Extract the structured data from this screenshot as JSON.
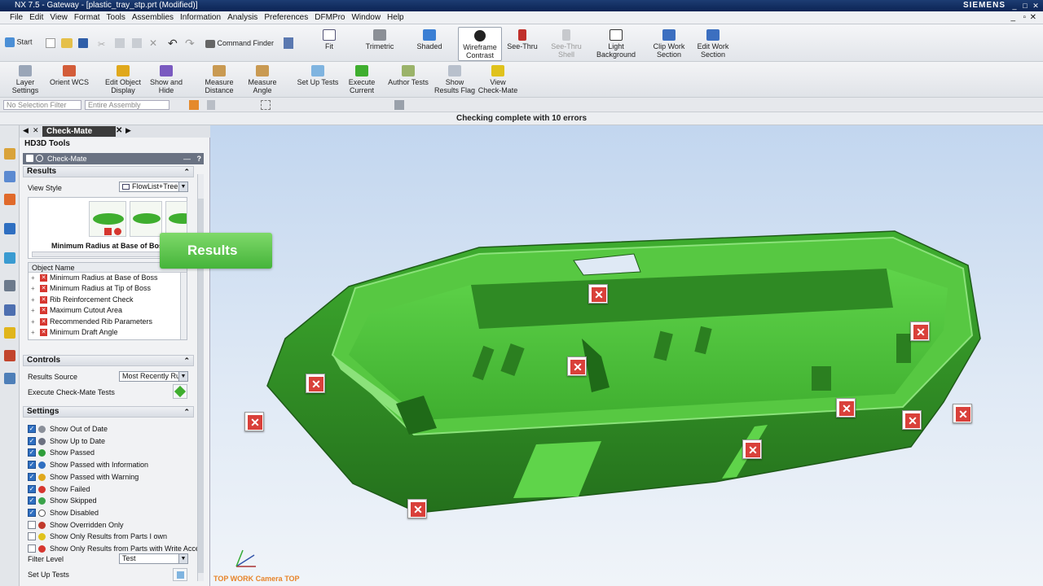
{
  "window": {
    "title": "NX 7.5 - Gateway - [plastic_tray_stp.prt (Modified)]",
    "brand": "SIEMENS"
  },
  "menu": [
    "File",
    "Edit",
    "View",
    "Format",
    "Tools",
    "Assemblies",
    "Information",
    "Analysis",
    "Preferences",
    "DFMPro",
    "Window",
    "Help"
  ],
  "toolbar1": {
    "start": "Start",
    "command_finder": "Command Finder",
    "fit": "Fit",
    "trimetric": "Trimetric",
    "shaded": "Shaded",
    "wireframe_1": "Wireframe",
    "wireframe_2": "Contrast",
    "see_thru": "See-Thru",
    "see_thru_shell_1": "See-Thru",
    "see_thru_shell_2": "Shell",
    "light_bg_1": "Light",
    "light_bg_2": "Background",
    "clip_work_1": "Clip Work",
    "clip_work_2": "Section",
    "edit_work_1": "Edit Work",
    "edit_work_2": "Section"
  },
  "toolbar2": {
    "layer_1": "Layer",
    "layer_2": "Settings",
    "orient": "Orient WCS",
    "edit_obj_1": "Edit Object",
    "edit_obj_2": "Display",
    "show_hide_1": "Show and",
    "show_hide_2": "Hide",
    "measure_dist_1": "Measure",
    "measure_dist_2": "Distance",
    "measure_angle_1": "Measure",
    "measure_angle_2": "Angle",
    "setup_tests": "Set Up Tests",
    "execute_1": "Execute",
    "execute_2": "Current",
    "author_tests": "Author Tests",
    "show_flag_1": "Show",
    "show_flag_2": "Results Flag",
    "view_cm_1": "View",
    "view_cm_2": "Check-Mate"
  },
  "filter": {
    "selection": "No Selection Filter",
    "scope": "Entire Assembly"
  },
  "status": "Checking complete with 10 errors",
  "panel": {
    "tab": "Check-Mate",
    "hd3d": "HD3D Tools",
    "checkmate_header": "Check-Mate",
    "results_section": "Results",
    "view_style_label": "View Style",
    "view_style_value": "FlowList+Tree",
    "thumb_caption": "Minimum Radius at Base of Boss",
    "object_name_header": "Object Name",
    "results": [
      "Minimum Radius at Base of Boss",
      "Minimum Radius at Tip of Boss",
      "Rib Reinforcement Check",
      "Maximum Cutout Area",
      "Recommended Rib Parameters",
      "Minimum Draft Angle"
    ],
    "controls_section": "Controls",
    "results_source_label": "Results Source",
    "results_source_value": "Most Recently Run",
    "execute_label": "Execute Check-Mate Tests",
    "settings_section": "Settings",
    "settings": [
      {
        "label": "Show Out of Date",
        "checked": true,
        "icon_color": "#8a8f99"
      },
      {
        "label": "Show Up to Date",
        "checked": true,
        "icon_color": "#6b7080"
      },
      {
        "label": "Show Passed",
        "checked": true,
        "icon_color": "#2e9e3a"
      },
      {
        "label": "Show Passed with Information",
        "checked": true,
        "icon_color": "#2f6fc1"
      },
      {
        "label": "Show Passed with Warning",
        "checked": true,
        "icon_color": "#e0a81c"
      },
      {
        "label": "Show Failed",
        "checked": true,
        "icon_color": "#d6362f"
      },
      {
        "label": "Show Skipped",
        "checked": true,
        "icon_color": "#3aa34a"
      },
      {
        "label": "Show Disabled",
        "checked": true,
        "icon_color": "#ffffff"
      },
      {
        "label": "Show Overridden Only",
        "checked": false,
        "icon_color": "#c0392b"
      },
      {
        "label": "Show Only Results from Parts I own",
        "checked": false,
        "icon_color": "#e0c21c"
      },
      {
        "label": "Show Only Results from Parts with Write Acce",
        "checked": false,
        "icon_color": "#d6362f"
      }
    ],
    "filter_level_label": "Filter Level",
    "filter_level_value": "Test",
    "setup_tests_label": "Set Up Tests"
  },
  "viewport": {
    "tooltip": "Results",
    "camera_label": "TOP WORK Camera TOP",
    "flag_glyph": "✕",
    "part_color": "#3fae2f",
    "part_dark": "#24701c",
    "part_light": "#5fd44a"
  },
  "icons": {
    "x_flag": "x-flag-icon",
    "checkbox_mark": "✓"
  }
}
